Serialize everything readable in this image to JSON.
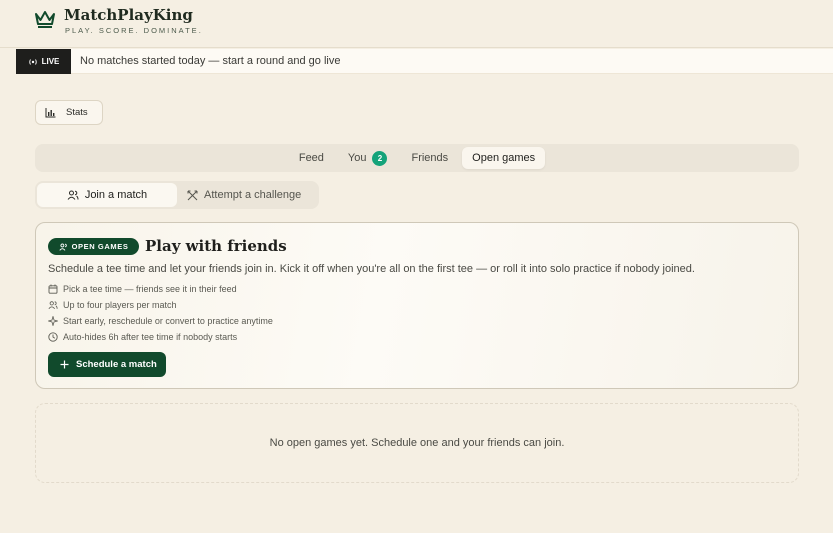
{
  "brand": {
    "name": "MatchPlayKing",
    "tagline": "PLAY. SCORE. DOMINATE.",
    "icon": "crown-icon"
  },
  "live": {
    "badge": "LIVE",
    "message": "No matches started today — start a round and go live"
  },
  "stats_button": {
    "label": "Stats",
    "icon": "bar-chart-icon"
  },
  "tabs": [
    {
      "label": "Feed"
    },
    {
      "label": "You",
      "count": "2"
    },
    {
      "label": "Friends"
    },
    {
      "label": "Open games",
      "active": true
    }
  ],
  "segment": [
    {
      "label": "Join a match",
      "icon": "users-icon",
      "active": true
    },
    {
      "label": "Attempt a challenge",
      "icon": "swords-icon"
    }
  ],
  "card": {
    "badge": "OPEN GAMES",
    "title": "Play with friends",
    "description": "Schedule a tee time and let your friends join in. Kick it off when you're all on the first tee — or roll it into solo practice if nobody joined.",
    "features": [
      {
        "text": "Pick a tee time — friends see it in their feed",
        "icon": "calendar-icon"
      },
      {
        "text": "Up to four players per match",
        "icon": "users-icon"
      },
      {
        "text": "Start early, reschedule or convert to practice anytime",
        "icon": "sparkle-icon"
      },
      {
        "text": "Auto-hides 6h after tee time if nobody starts",
        "icon": "clock-icon"
      }
    ],
    "button": "Schedule a match"
  },
  "empty_state": "No open games yet. Schedule one and your friends can join.",
  "colors": {
    "brand_green": "#114a2c",
    "badge_green": "#14a37a",
    "background": "#f5efe3"
  }
}
